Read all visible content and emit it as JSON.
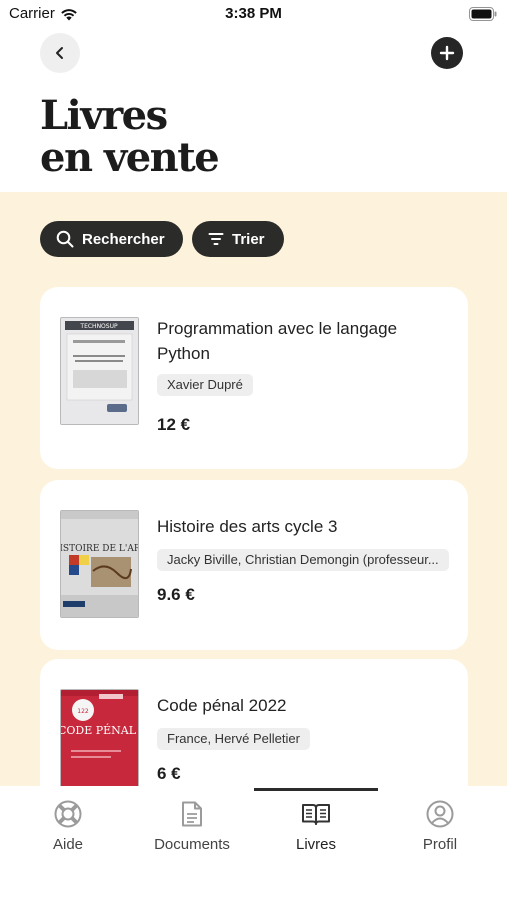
{
  "status_bar": {
    "carrier": "Carrier",
    "time": "3:38 PM"
  },
  "header": {
    "title_line1": "Livres",
    "title_line2": "en vente"
  },
  "filters": {
    "search_label": "Rechercher",
    "sort_label": "Trier"
  },
  "books": [
    {
      "title": "Programmation avec le langage Python",
      "author": "Xavier Dupré",
      "price": "12 €",
      "cover_text": "TECHNOSUP"
    },
    {
      "title": "Histoire des arts cycle 3",
      "author": "Jacky Biville, Christian Demongin (professeur...",
      "price": "9.6 €",
      "cover_text": "HISTOIRE DE L'ART"
    },
    {
      "title": "Code pénal 2022",
      "author": "France, Hervé Pelletier",
      "price": "6 €",
      "cover_text": "CODE PÉNAL"
    }
  ],
  "tabbar": {
    "items": [
      {
        "label": "Aide",
        "icon": "lifebuoy-icon"
      },
      {
        "label": "Documents",
        "icon": "document-icon"
      },
      {
        "label": "Livres",
        "icon": "open-book-icon",
        "active": true
      },
      {
        "label": "Profil",
        "icon": "user-circle-icon"
      }
    ]
  },
  "colors": {
    "beige_bg": "#fdf2dc",
    "dark_chip": "#2b2b2a",
    "card_bg": "#ffffff"
  }
}
